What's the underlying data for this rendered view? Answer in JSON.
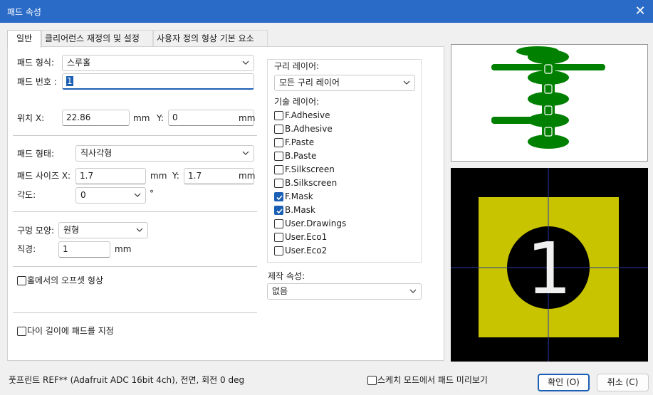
{
  "window": {
    "title": "패드 속성",
    "close_glyph": "✕"
  },
  "tabs": [
    "일반",
    "클리어런스 재정의 및 설정",
    "사용자 정의 형상 기본 요소"
  ],
  "general": {
    "pad_type_label": "패드 형식:",
    "pad_type_value": "스루홀",
    "pad_number_label": "패드 번호 :",
    "pad_number_value": "1",
    "position_x_label": "위치 X:",
    "position_x_value": "22.86",
    "position_x_unit": "mm",
    "position_y_label": "Y:",
    "position_y_value": "0",
    "position_y_unit": "mm",
    "pad_shape_label": "패드 형태:",
    "pad_shape_value": "직사각형",
    "pad_size_label": "패드 사이즈 X:",
    "pad_size_x_value": "1.7",
    "pad_size_x_unit": "mm",
    "pad_size_y_label": "Y:",
    "pad_size_y_value": "1.7",
    "pad_size_y_unit": "mm",
    "angle_label": "각도:",
    "angle_value": "0",
    "angle_unit": "°",
    "hole_shape_label": "구멍 모양:",
    "hole_shape_value": "원형",
    "diameter_label": "직경:",
    "diameter_value": "1",
    "diameter_unit": "mm",
    "offset_label": "홀에서의 오프셋 형상",
    "die_length_label": "다이 길이에 패드를 지정"
  },
  "layers": {
    "copper_label": "구리 레이어:",
    "copper_value": "모든 구리 레이어",
    "tech_label": "기술 레이어:",
    "items": [
      {
        "name": "F.Adhesive",
        "checked": false
      },
      {
        "name": "B.Adhesive",
        "checked": false
      },
      {
        "name": "F.Paste",
        "checked": false
      },
      {
        "name": "B.Paste",
        "checked": false
      },
      {
        "name": "F.Silkscreen",
        "checked": false
      },
      {
        "name": "B.Silkscreen",
        "checked": false
      },
      {
        "name": "F.Mask",
        "checked": true
      },
      {
        "name": "B.Mask",
        "checked": true
      },
      {
        "name": "User.Drawings",
        "checked": false
      },
      {
        "name": "User.Eco1",
        "checked": false
      },
      {
        "name": "User.Eco2",
        "checked": false
      }
    ],
    "fab_label": "제작 속성:",
    "fab_value": "없음"
  },
  "preview": {
    "pad_label": "1"
  },
  "footer": {
    "status": "풋프린트 REF** (Adafruit ADC 16bit 4ch), 전면, 회전 0 deg",
    "sketch_label": "스케치 모드에서 패드 미리보기",
    "ok_label": "확인 (O)",
    "cancel_label": "취소 (C)"
  },
  "colors": {
    "titlebar": "#2a6bc7",
    "accent": "#1a5fb4",
    "pad_green": "#008000",
    "pad_yellow": "#c8c400"
  }
}
